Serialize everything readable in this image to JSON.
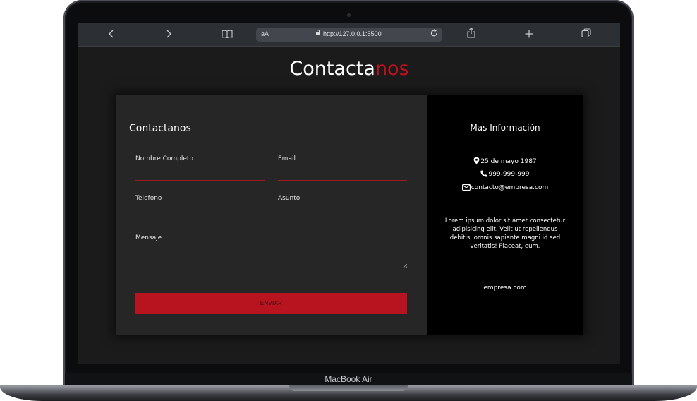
{
  "device": {
    "brand": "MacBook Air"
  },
  "browser": {
    "text_size_label": "aA",
    "url": "http://127.0.0.1:5500",
    "icons": [
      "chevron-left-icon",
      "chevron-right-icon",
      "book-icon",
      "lock-icon",
      "reload-icon",
      "share-icon",
      "plus-icon",
      "tabs-icon"
    ]
  },
  "page": {
    "title_main": "Contacta",
    "title_accent": "nos",
    "accent_color": "#c0101e"
  },
  "form": {
    "heading": "Contactanos",
    "fields": {
      "name": {
        "label": "Nombre Completo",
        "value": ""
      },
      "email": {
        "label": "Email",
        "value": ""
      },
      "phone": {
        "label": "Telefono",
        "value": ""
      },
      "subject": {
        "label": "Asunto",
        "value": ""
      },
      "message": {
        "label": "Mensaje",
        "value": ""
      }
    },
    "submit_label": "ENVIAR"
  },
  "info": {
    "heading": "Mas Información",
    "address": "25 de mayo 1987",
    "phone": "999-999-999",
    "email": "contacto@empresa.com",
    "description": "Lorem ipsum dolor sit amet consectetur adipisicing elit. Velit ut repellendus debitis, omnis sapiente magni id sed veritatis! Placeat, eum.",
    "website": "empresa.com"
  }
}
